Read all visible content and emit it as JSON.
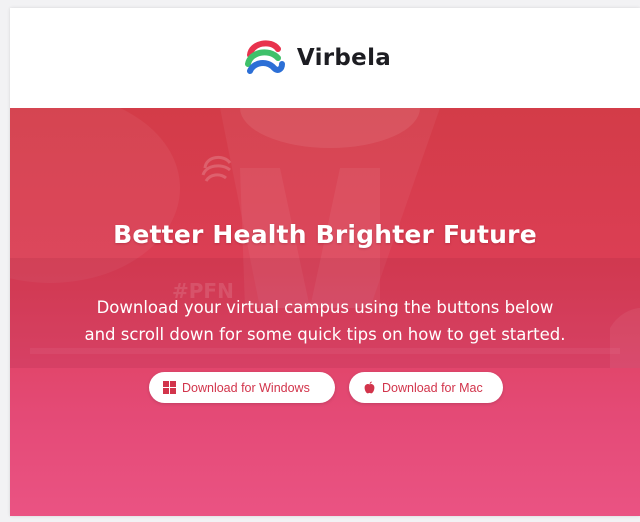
{
  "brand": {
    "name": "Virbela",
    "logo_icon": "virbela-logo-icon"
  },
  "hero": {
    "title": "Better Health Brighter Future",
    "subtitle_line1": "Download your virtual campus using the buttons below",
    "subtitle_line2": "and scroll down for some quick tips on how to get started.",
    "background_text": "#PFN"
  },
  "buttons": {
    "windows": {
      "label": "Download for Windows",
      "icon": "windows-icon"
    },
    "mac": {
      "label": "Download for Mac",
      "icon": "apple-icon"
    }
  },
  "colors": {
    "hero_top": "#d33c48",
    "hero_bottom": "#ea5383",
    "button_text": "#d2344b",
    "logo_green": "#3fc06a",
    "logo_blue": "#2c6fd6",
    "logo_red": "#e8324d"
  }
}
